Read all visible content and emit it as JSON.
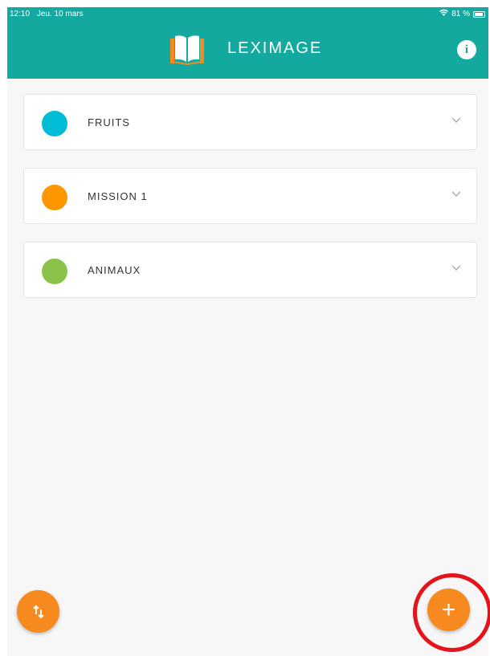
{
  "status_bar": {
    "time": "12:10",
    "date": "Jeu. 10 mars",
    "battery": "81 %",
    "wifi_icon": "wifi-icon",
    "battery_icon": "battery-icon"
  },
  "header": {
    "title": "LEXIMAGE",
    "logo_icon": "book-icon",
    "info_icon": "info-icon",
    "background_color": "#14a99f"
  },
  "categories": [
    {
      "label": "FRUITS",
      "color": "#00bcd4"
    },
    {
      "label": "MISSION 1",
      "color": "#ff9800"
    },
    {
      "label": "ANIMAUX",
      "color": "#8bc34a"
    }
  ],
  "actions": {
    "sort_icon": "sort-arrows-icon",
    "add_icon": "plus-icon",
    "add_label": "+",
    "accent_color": "#f68a1f"
  },
  "annotation": {
    "highlight_color": "#e4141a"
  }
}
